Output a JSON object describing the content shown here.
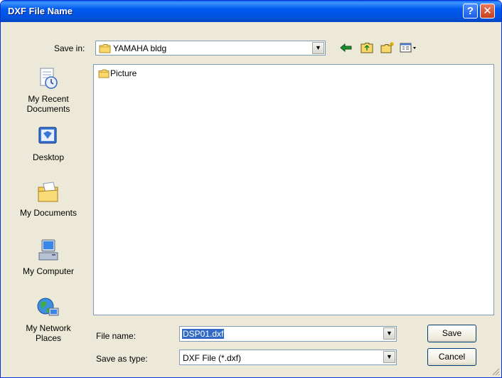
{
  "window": {
    "title": "DXF File Name",
    "help_glyph": "?",
    "close_glyph": "✕"
  },
  "save_in": {
    "label": "Save in:",
    "value": "YAMAHA bldg"
  },
  "toolbar": {
    "icons": [
      "back-arrow-icon",
      "up-folder-icon",
      "new-folder-icon",
      "views-menu-icon"
    ]
  },
  "places": [
    {
      "label": "My Recent Documents",
      "icon": "recent-documents-icon"
    },
    {
      "label": "Desktop",
      "icon": "desktop-icon"
    },
    {
      "label": "My Documents",
      "icon": "my-documents-icon"
    },
    {
      "label": "My Computer",
      "icon": "my-computer-icon"
    },
    {
      "label": "My Network Places",
      "icon": "network-places-icon"
    }
  ],
  "files": [
    {
      "name": "Picture",
      "icon": "folder-icon"
    }
  ],
  "file_name": {
    "label": "File name:",
    "value": "DSP01.dxf"
  },
  "save_as_type": {
    "label": "Save as type:",
    "value": "DXF File (*.dxf)"
  },
  "buttons": {
    "save": "Save",
    "cancel": "Cancel"
  },
  "colors": {
    "titlebar": "#0058ee",
    "dialog_bg": "#ece9d8",
    "selection": "#316ac5"
  }
}
